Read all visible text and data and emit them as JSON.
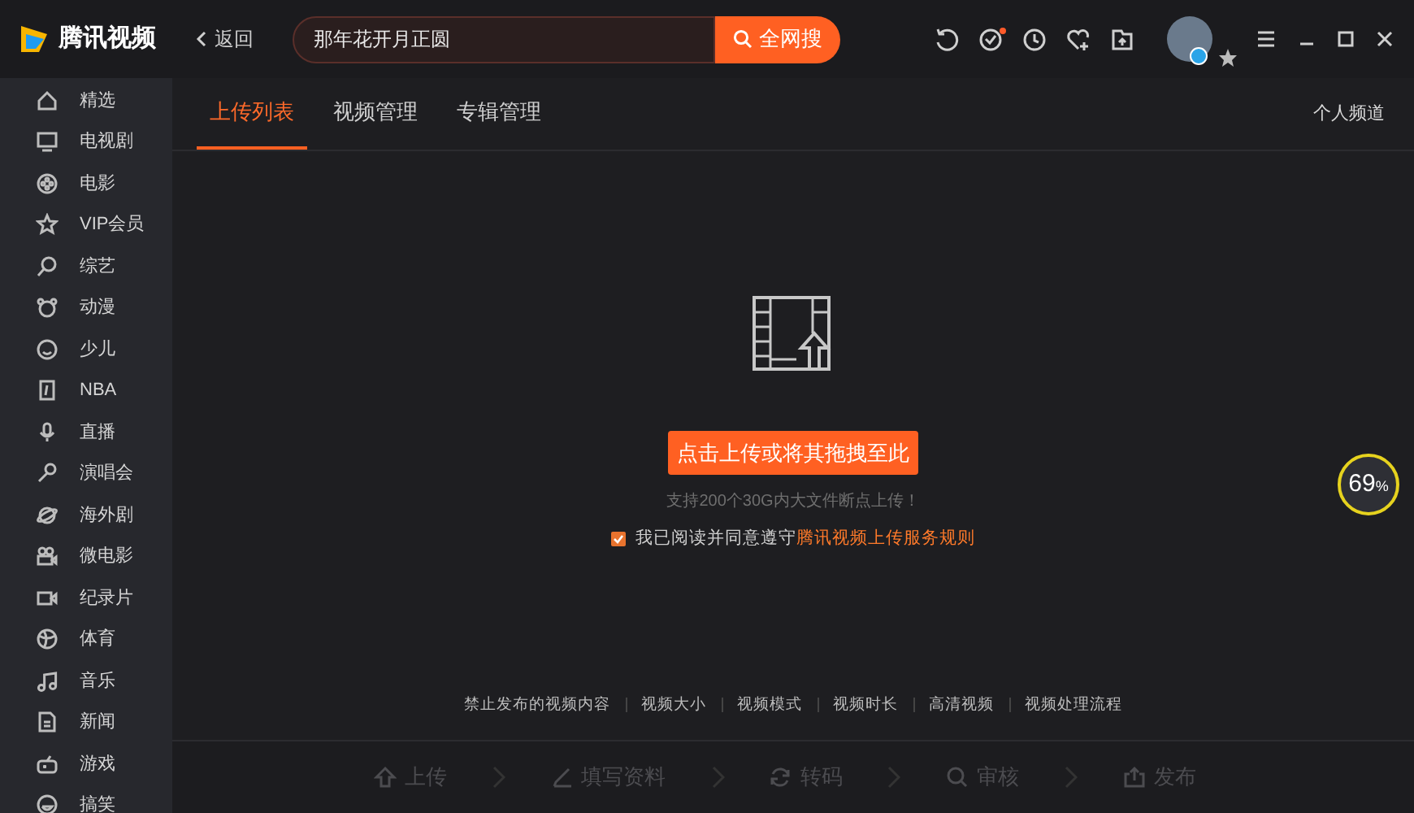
{
  "app": {
    "logo": "腾讯视频",
    "back": "返回",
    "search": {
      "value": "那年花开月正圆",
      "button": "全网搜"
    }
  },
  "sidebar": {
    "items": [
      {
        "label": "精选",
        "selected": false
      },
      {
        "label": "电视剧",
        "selected": false
      },
      {
        "label": "电影",
        "selected": false
      },
      {
        "label": "VIP会员",
        "selected": false
      },
      {
        "label": "综艺",
        "selected": false
      },
      {
        "label": "动漫",
        "selected": false
      },
      {
        "label": "少儿",
        "selected": false
      },
      {
        "label": "NBA",
        "selected": false
      },
      {
        "label": "直播",
        "selected": false
      },
      {
        "label": "演唱会",
        "selected": false
      },
      {
        "label": "海外剧",
        "selected": false
      },
      {
        "label": "微电影",
        "selected": false
      },
      {
        "label": "纪录片",
        "selected": false
      },
      {
        "label": "体育",
        "selected": false
      },
      {
        "label": "音乐",
        "selected": false
      },
      {
        "label": "新闻",
        "selected": false
      },
      {
        "label": "游戏",
        "selected": false
      },
      {
        "label": "搞笑",
        "selected": false
      }
    ]
  },
  "tabs": [
    {
      "label": "上传列表",
      "selected": true
    },
    {
      "label": "视频管理",
      "selected": false
    },
    {
      "label": "专辑管理",
      "selected": false
    }
  ],
  "channel_link": "个人频道",
  "upload": {
    "button": "点击上传或将其拖拽至此",
    "hint": "支持200个30G内大文件断点上传！",
    "agree": {
      "checked": true,
      "text": "我已阅读并同意遵守",
      "link": "腾讯视频上传服务规则"
    }
  },
  "footer_links": [
    "禁止发布的视频内容",
    "视频大小",
    "视频模式",
    "视频时长",
    "高清视频",
    "视频处理流程"
  ],
  "steps": [
    {
      "label": "上传",
      "disabled": true
    },
    {
      "label": "填写资料",
      "disabled": true
    },
    {
      "label": "转码",
      "disabled": true
    },
    {
      "label": "审核",
      "disabled": true
    },
    {
      "label": "发布",
      "disabled": true
    }
  ],
  "speed_ball": {
    "value": "69",
    "unit": "%"
  }
}
